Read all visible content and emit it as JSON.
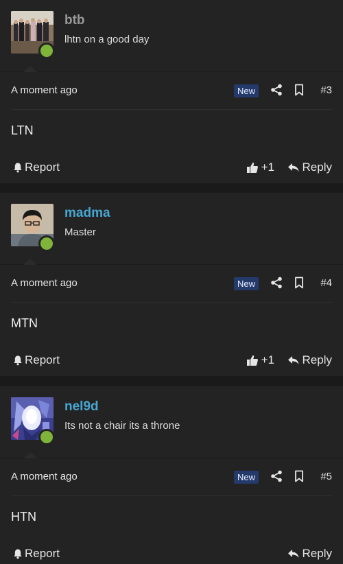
{
  "posts": [
    {
      "username": "btb",
      "username_color": "#9a9a9a",
      "user_title": "lhtn on a good day",
      "timestamp": "A moment ago",
      "badge": "New",
      "post_number": "#3",
      "message": "LTN",
      "report_label": "Report",
      "like_label": "+1",
      "reply_label": "Reply",
      "avatar": "group-photo"
    },
    {
      "username": "madma",
      "username_color": "#47a7d2",
      "user_title": "Master",
      "timestamp": "A moment ago",
      "badge": "New",
      "post_number": "#4",
      "message": "MTN",
      "report_label": "Report",
      "like_label": "+1",
      "reply_label": "Reply",
      "avatar": "person-with-glasses"
    },
    {
      "username": "nel9d",
      "username_color": "#47a7d2",
      "user_title": "Its not a chair its a throne",
      "timestamp": "A moment ago",
      "badge": "New",
      "post_number": "#5",
      "message": "HTN",
      "report_label": "Report",
      "reply_label": "Reply",
      "avatar": "abstract-art"
    }
  ],
  "colors": {
    "background": "#1a1a1a",
    "panel": "#232323",
    "online": "#7fb33a",
    "badge_bg": "#243a6b",
    "link_blue": "#47a7d2"
  }
}
